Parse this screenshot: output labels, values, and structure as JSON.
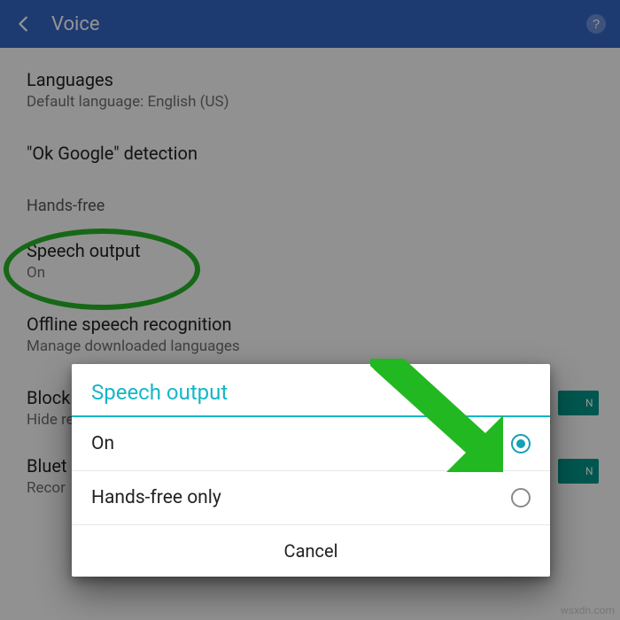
{
  "appbar": {
    "title": "Voice"
  },
  "settings": {
    "languages": {
      "title": "Languages",
      "subtitle": "Default language: English (US)"
    },
    "okgoogle": {
      "title": "\"Ok Google\" detection"
    },
    "handsfree_header": "Hands-free",
    "speech_output": {
      "title": "Speech output",
      "subtitle": "On"
    },
    "offline": {
      "title": "Offline speech recognition",
      "subtitle": "Manage downloaded languages"
    },
    "block": {
      "title": "Block",
      "subtitle": "Hide re",
      "toggle": "N"
    },
    "bluetooth": {
      "title": "Bluet",
      "subtitle": "Recor",
      "toggle": "N"
    }
  },
  "dialog": {
    "title": "Speech output",
    "options": [
      {
        "label": "On",
        "selected": true
      },
      {
        "label": "Hands-free only",
        "selected": false
      }
    ],
    "cancel": "Cancel"
  },
  "colors": {
    "brand": "#3266c1",
    "accent": "#14b6c7",
    "highlight": "#27b327",
    "toggle": "#009688"
  },
  "watermark": "wsxdn.com"
}
